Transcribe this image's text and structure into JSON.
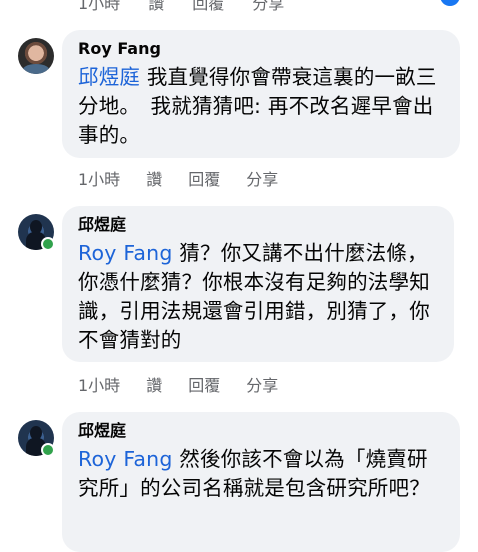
{
  "top_partial": {
    "actions": [
      "1小時",
      "讚",
      "回覆",
      "分享"
    ]
  },
  "comments": [
    {
      "author": "Roy Fang",
      "mention": "邱煜庭",
      "text": " 我直覺得你會帶衰這裏的一畝三分地。　我就猜猜吧: 再不改名遲早會出事的。",
      "time": "1小時",
      "like": "讚",
      "reply": "回覆",
      "share": "分享"
    },
    {
      "author": "邱煜庭",
      "mention": "Roy Fang",
      "text": " 猜？你又講不出什麼法條，你憑什麼猜？你根本沒有足夠的法學知識，引用法規還會引用錯，別猜了，你不會猜對的",
      "time": "1小時",
      "like": "讚",
      "reply": "回覆",
      "share": "分享"
    },
    {
      "author": "邱煜庭",
      "mention": "Roy Fang",
      "text": " 然後你該不會以為「燒賣研究所」的公司名稱就是包含研究所吧？"
    }
  ],
  "colors": {
    "mention": "#1d64d8",
    "bubble": "#f0f2f5",
    "online": "#31a24c",
    "secondary_text": "#65676b"
  }
}
